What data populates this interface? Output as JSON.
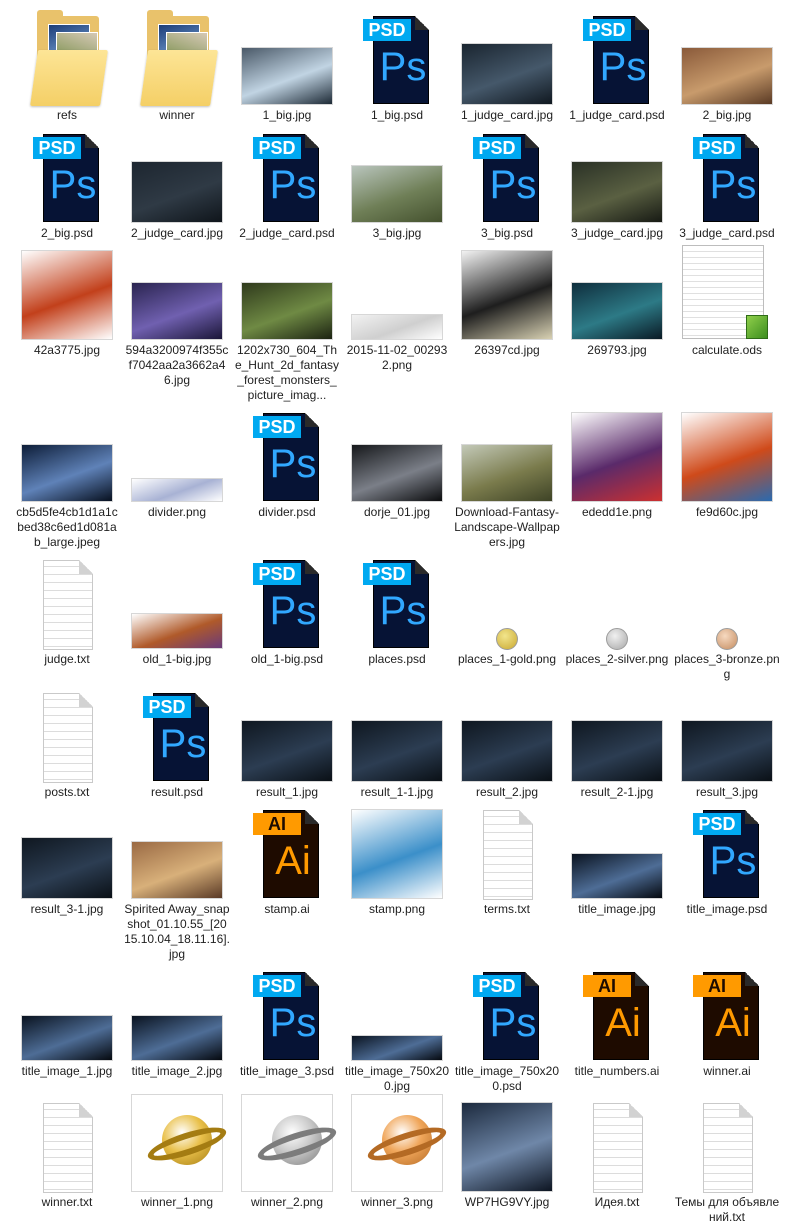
{
  "files": [
    {
      "name": "refs",
      "kind": "folder",
      "row": 0,
      "col": 0
    },
    {
      "name": "winner",
      "kind": "folder",
      "row": 0,
      "col": 1
    },
    {
      "name": "1_big.jpg",
      "kind": "photo",
      "row": 0,
      "col": 2,
      "colors": [
        "#4a5968",
        "#c1d4e3",
        "#1d2a36"
      ]
    },
    {
      "name": "1_big.psd",
      "kind": "psd",
      "row": 0,
      "col": 3
    },
    {
      "name": "1_judge_card.jpg",
      "kind": "photo",
      "row": 0,
      "col": 4,
      "colors": [
        "#1a2530",
        "#45586a",
        "#101820"
      ]
    },
    {
      "name": "1_judge_card.psd",
      "kind": "psd",
      "row": 0,
      "col": 5
    },
    {
      "name": "2_big.jpg",
      "kind": "photo",
      "row": 0,
      "col": 6,
      "colors": [
        "#8a5a3a",
        "#c89b6c",
        "#5a3a24"
      ]
    },
    {
      "name": "2_big.psd",
      "kind": "psd",
      "row": 1,
      "col": 0
    },
    {
      "name": "2_judge_card.jpg",
      "kind": "photo",
      "row": 1,
      "col": 1,
      "colors": [
        "#1d2630",
        "#2f3a45",
        "#0f151b"
      ]
    },
    {
      "name": "2_judge_card.psd",
      "kind": "psd",
      "row": 1,
      "col": 2
    },
    {
      "name": "3_big.jpg",
      "kind": "photo",
      "row": 1,
      "col": 3,
      "colors": [
        "#b9c5bd",
        "#6f7f57",
        "#44512e"
      ]
    },
    {
      "name": "3_big.psd",
      "kind": "psd",
      "row": 1,
      "col": 4
    },
    {
      "name": "3_judge_card.jpg",
      "kind": "photo",
      "row": 1,
      "col": 5,
      "colors": [
        "#2a3126",
        "#5a6042",
        "#171a14"
      ]
    },
    {
      "name": "3_judge_card.psd",
      "kind": "psd",
      "row": 1,
      "col": 6
    },
    {
      "name": "42a3775.jpg",
      "kind": "photo",
      "row": 2,
      "col": 0,
      "colors": [
        "#ffffff",
        "#c2401b",
        "#ffffff"
      ]
    },
    {
      "name": "594a3200974f355cf7042aa2a3662a46.jpg",
      "kind": "photo",
      "row": 2,
      "col": 1,
      "colors": [
        "#2a2450",
        "#7060b0",
        "#1b1638"
      ]
    },
    {
      "name": "1202x730_604_The_Hunt_2d_fantasy_forest_monsters_picture_imag...",
      "kind": "photo",
      "row": 2,
      "col": 2,
      "colors": [
        "#2f3a1c",
        "#6f8a44",
        "#1c2312"
      ]
    },
    {
      "name": "2015-11-02_002932.png",
      "kind": "photo",
      "row": 2,
      "col": 3,
      "colors": [
        "#f2f2f2",
        "#cfcfcf",
        "#ffffff"
      ]
    },
    {
      "name": "26397cd.jpg",
      "kind": "photo",
      "row": 2,
      "col": 4,
      "colors": [
        "#f3f3f3",
        "#1e1e1e",
        "#d8d1b3"
      ]
    },
    {
      "name": "269793.jpg",
      "kind": "photo",
      "row": 2,
      "col": 5,
      "colors": [
        "#0f2e3d",
        "#2d7a86",
        "#0a1a25"
      ]
    },
    {
      "name": "calculate.ods",
      "kind": "sheet",
      "row": 2,
      "col": 6
    },
    {
      "name": "cb5d5fe4cb1d1a1cbed38c6ed1d081ab_large.jpeg",
      "kind": "photo",
      "row": 3,
      "col": 0,
      "colors": [
        "#0d1d38",
        "#5f82b8",
        "#07101f"
      ]
    },
    {
      "name": "divider.png",
      "kind": "photo",
      "row": 3,
      "col": 1,
      "colors": [
        "#ffffff",
        "#a8b2d4",
        "#ffffff"
      ]
    },
    {
      "name": "divider.psd",
      "kind": "psd",
      "row": 3,
      "col": 2
    },
    {
      "name": "dorje_01.jpg",
      "kind": "photo",
      "row": 3,
      "col": 3,
      "colors": [
        "#16181b",
        "#7b7f88",
        "#0b0c0e"
      ]
    },
    {
      "name": "Download-Fantasy-Landscape-Wallpapers.jpg",
      "kind": "photo",
      "row": 3,
      "col": 4,
      "colors": [
        "#c3c9b8",
        "#7a7b4c",
        "#3e4326"
      ]
    },
    {
      "name": "ededd1e.png",
      "kind": "photo",
      "row": 3,
      "col": 5,
      "colors": [
        "#ffffff",
        "#5a2a6a",
        "#cc3030"
      ]
    },
    {
      "name": "fe9d60c.jpg",
      "kind": "photo",
      "row": 3,
      "col": 6,
      "colors": [
        "#ffffff",
        "#cf4a1a",
        "#2a6ab0"
      ]
    },
    {
      "name": "judge.txt",
      "kind": "txt",
      "row": 4,
      "col": 0
    },
    {
      "name": "old_1-big.jpg",
      "kind": "photo",
      "row": 4,
      "col": 1,
      "colors": [
        "#ffffff",
        "#b05a2a",
        "#6a3a7a"
      ]
    },
    {
      "name": "old_1-big.psd",
      "kind": "psd",
      "row": 4,
      "col": 2
    },
    {
      "name": "places.psd",
      "kind": "psd",
      "row": 4,
      "col": 3
    },
    {
      "name": "places_1-gold.png",
      "kind": "medal",
      "row": 4,
      "col": 4,
      "colors": [
        "#f2e58c",
        "#c9a830"
      ]
    },
    {
      "name": "places_2-silver.png",
      "kind": "medal",
      "row": 4,
      "col": 5,
      "colors": [
        "#f0f0f0",
        "#a8a8a8"
      ]
    },
    {
      "name": "places_3-bronze.png",
      "kind": "medal",
      "row": 4,
      "col": 6,
      "colors": [
        "#f6d9c0",
        "#c48c60"
      ]
    },
    {
      "name": "posts.txt",
      "kind": "txt",
      "row": 5,
      "col": 0
    },
    {
      "name": "result.psd",
      "kind": "psd",
      "row": 5,
      "col": 1
    },
    {
      "name": "result_1.jpg",
      "kind": "photo",
      "row": 5,
      "col": 2,
      "colors": [
        "#0f1720",
        "#2c3d52",
        "#0a1016"
      ]
    },
    {
      "name": "result_1-1.jpg",
      "kind": "photo",
      "row": 5,
      "col": 3,
      "colors": [
        "#0f1720",
        "#2c3d52",
        "#0a1016"
      ]
    },
    {
      "name": "result_2.jpg",
      "kind": "photo",
      "row": 5,
      "col": 4,
      "colors": [
        "#0f1720",
        "#2c3d52",
        "#0a1016"
      ]
    },
    {
      "name": "result_2-1.jpg",
      "kind": "photo",
      "row": 5,
      "col": 5,
      "colors": [
        "#0f1720",
        "#2c3d52",
        "#0a1016"
      ]
    },
    {
      "name": "result_3.jpg",
      "kind": "photo",
      "row": 5,
      "col": 6,
      "colors": [
        "#0f1720",
        "#2c3d52",
        "#0a1016"
      ]
    },
    {
      "name": "result_3-1.jpg",
      "kind": "photo",
      "row": 6,
      "col": 0,
      "colors": [
        "#0f1720",
        "#2c3d52",
        "#0a1016"
      ]
    },
    {
      "name": "Spirited Away_snapshot_01.10.55_[2015.10.04_18.11.16].jpg",
      "kind": "photo",
      "row": 6,
      "col": 1,
      "colors": [
        "#9a6a44",
        "#d8b07a",
        "#5a3a26"
      ]
    },
    {
      "name": "stamp.ai",
      "kind": "ai",
      "row": 6,
      "col": 2
    },
    {
      "name": "stamp.png",
      "kind": "photo",
      "row": 6,
      "col": 3,
      "colors": [
        "#ffffff",
        "#3b8fc9",
        "#ffffff"
      ]
    },
    {
      "name": "terms.txt",
      "kind": "txt",
      "row": 6,
      "col": 4
    },
    {
      "name": "title_image.jpg",
      "kind": "photo",
      "row": 6,
      "col": 5,
      "colors": [
        "#0a1320",
        "#4e6d96",
        "#05090f"
      ]
    },
    {
      "name": "title_image.psd",
      "kind": "psd",
      "row": 6,
      "col": 6
    },
    {
      "name": "title_image_1.jpg",
      "kind": "photo",
      "row": 7,
      "col": 0,
      "colors": [
        "#0a1320",
        "#4e6d96",
        "#05090f"
      ]
    },
    {
      "name": "title_image_2.jpg",
      "kind": "photo",
      "row": 7,
      "col": 1,
      "colors": [
        "#0a1320",
        "#4e6d96",
        "#05090f"
      ]
    },
    {
      "name": "title_image_3.psd",
      "kind": "psd",
      "row": 7,
      "col": 2
    },
    {
      "name": "title_image_750x200.jpg",
      "kind": "photo",
      "row": 7,
      "col": 3,
      "colors": [
        "#0a1320",
        "#4e6d96",
        "#05090f"
      ]
    },
    {
      "name": "title_image_750x200.psd",
      "kind": "psd",
      "row": 7,
      "col": 4
    },
    {
      "name": "title_numbers.ai",
      "kind": "ai",
      "row": 7,
      "col": 5
    },
    {
      "name": "winner.ai",
      "kind": "ai",
      "row": 7,
      "col": 6
    },
    {
      "name": "winner.txt",
      "kind": "txt",
      "row": 8,
      "col": 0
    },
    {
      "name": "winner_1.png",
      "kind": "ring",
      "row": 8,
      "col": 1,
      "colors": [
        "#e9c04a",
        "#a47c12"
      ]
    },
    {
      "name": "winner_2.png",
      "kind": "ring",
      "row": 8,
      "col": 2,
      "colors": [
        "#c9c9c9",
        "#7c7c7c"
      ]
    },
    {
      "name": "winner_3.png",
      "kind": "ring",
      "row": 8,
      "col": 3,
      "colors": [
        "#f0a65a",
        "#b46a24"
      ]
    },
    {
      "name": "WP7HG9VY.jpg",
      "kind": "photo",
      "row": 8,
      "col": 4,
      "colors": [
        "#1c2a3e",
        "#6f87a8",
        "#0d1522"
      ]
    },
    {
      "name": "Идея.txt",
      "kind": "txt",
      "row": 8,
      "col": 5
    },
    {
      "name": "Темы для объявлений.txt",
      "kind": "txt",
      "row": 8,
      "col": 6
    }
  ],
  "icons": {
    "psd_tag": "PSD",
    "psd_mark": "Ps",
    "ai_tag": "AI",
    "ai_mark": "Ai"
  }
}
